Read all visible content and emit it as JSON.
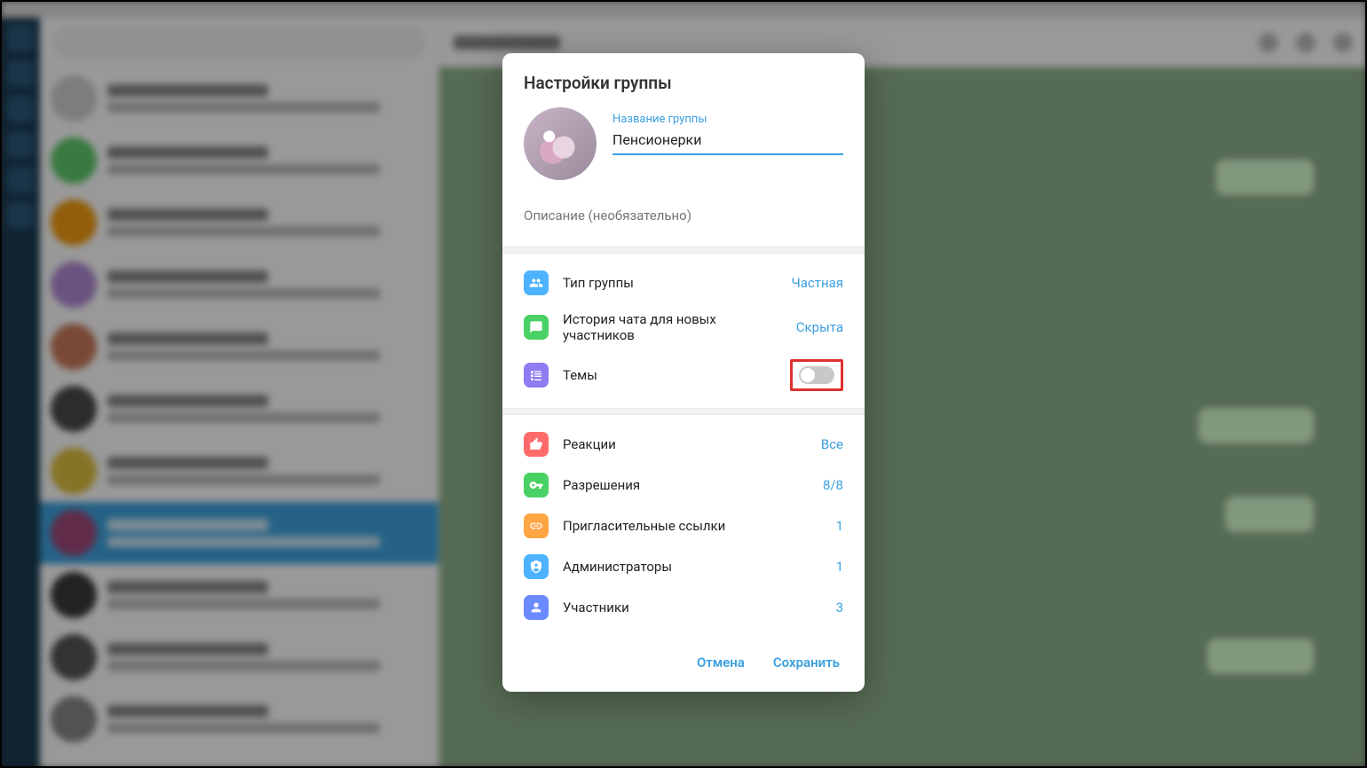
{
  "modal": {
    "title": "Настройки группы",
    "name_label": "Название группы",
    "name_value": "Пенсионерки",
    "description_placeholder": "Описание (необязательно)",
    "settings1": [
      {
        "icon": "group-icon",
        "bg": "ic-blue",
        "label": "Тип группы",
        "value": "Частная"
      },
      {
        "icon": "chat-icon",
        "bg": "ic-green",
        "label": "История чата для новых участников",
        "value": "Скрыта"
      },
      {
        "icon": "topics-icon",
        "bg": "ic-purple",
        "label": "Темы",
        "toggle": true
      }
    ],
    "settings2": [
      {
        "icon": "thumb-icon",
        "bg": "ic-red",
        "label": "Реакции",
        "value": "Все"
      },
      {
        "icon": "key-icon",
        "bg": "ic-green2",
        "label": "Разрешения",
        "value": "8/8"
      },
      {
        "icon": "link-icon",
        "bg": "ic-orange",
        "label": "Пригласительные ссылки",
        "value": "1"
      },
      {
        "icon": "shield-icon",
        "bg": "ic-teal",
        "label": "Администраторы",
        "value": "1"
      },
      {
        "icon": "members-icon",
        "bg": "ic-blue2",
        "label": "Участники",
        "value": "3"
      }
    ],
    "cancel": "Отмена",
    "save": "Сохранить"
  },
  "bg_chats": [
    {
      "color": "#d0d0d0"
    },
    {
      "color": "#5ecb6a"
    },
    {
      "color": "#f39c12"
    },
    {
      "color": "#b28bd4"
    },
    {
      "color": "#c97a5a"
    },
    {
      "color": "#4a4a4a"
    },
    {
      "color": "#e0c040"
    },
    {
      "color": "#a04a7a",
      "active": true
    },
    {
      "color": "#3a3a3a"
    },
    {
      "color": "#555"
    },
    {
      "color": "#888"
    }
  ]
}
